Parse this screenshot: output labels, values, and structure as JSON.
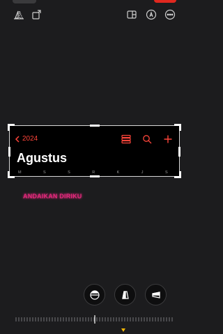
{
  "toolbar": {
    "left_icons": [
      "shape-icon",
      "rotate-icon"
    ],
    "right_icons": [
      "aspect-ratio-icon",
      "markup-icon",
      "more-icon"
    ]
  },
  "card": {
    "back_label": "2024",
    "month": "Agustus",
    "weekdays": [
      "M",
      "S",
      "S",
      "R",
      "K",
      "J",
      "S"
    ],
    "accent": "#ff453a"
  },
  "overlay": {
    "text": "ANDAIKAN DIRIKU",
    "color": "#e0287a"
  },
  "tools": [
    "level-icon",
    "perspective-vertical-icon",
    "perspective-horizontal-icon"
  ],
  "ruler": {
    "indicator_color": "#f2b705"
  }
}
